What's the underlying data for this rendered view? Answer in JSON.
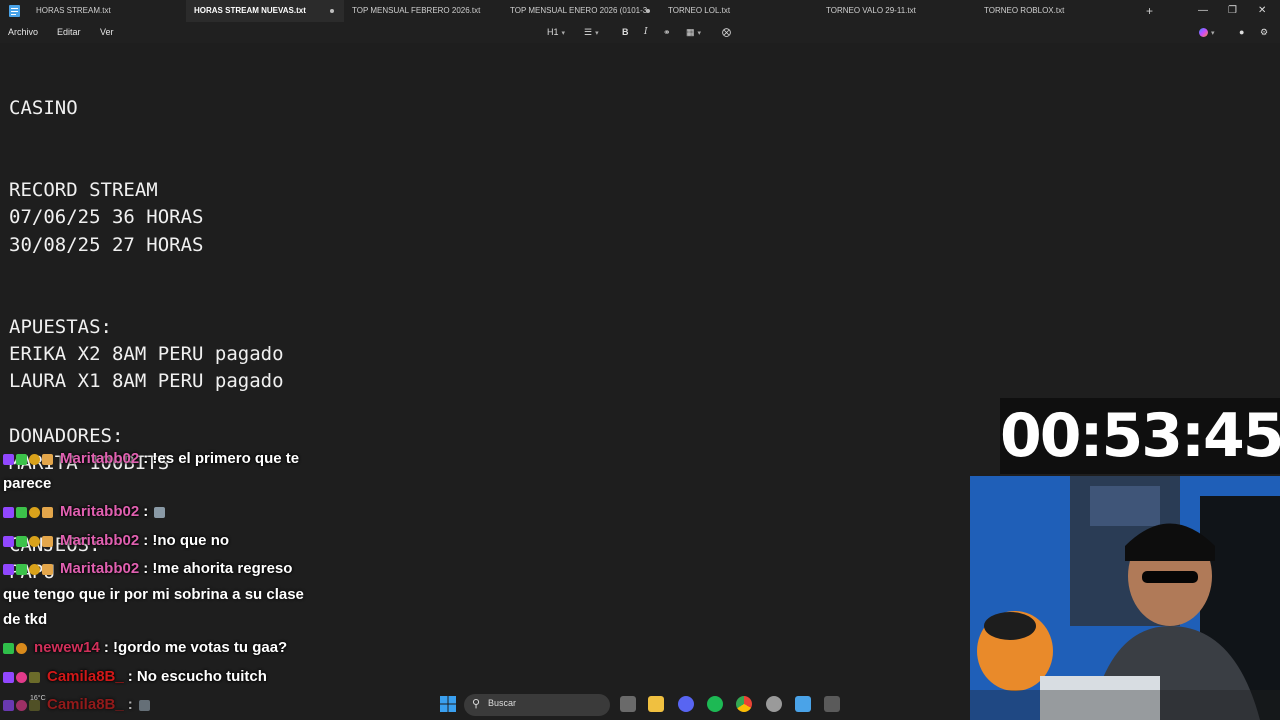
{
  "tabs": [
    {
      "label": "HORAS STREAM.txt"
    },
    {
      "label": "HORAS STREAM NUEVAS.txt"
    },
    {
      "label": "TOP MENSUAL FEBRERO 2026.txt"
    },
    {
      "label": "TOP MENSUAL ENERO 2026 (0101-3"
    },
    {
      "label": "TORNEO LOL.txt"
    },
    {
      "label": "TORNEO VALO 29-11.txt"
    },
    {
      "label": "TORNEO ROBLOX.txt"
    }
  ],
  "menu": {
    "file": "Archivo",
    "edit": "Editar",
    "view": "Ver"
  },
  "toolbar": {
    "heading": "H1"
  },
  "editor": {
    "lines": [
      "CASINO",
      "RECORD STREAM",
      "07/06/25 36 HORAS",
      "30/08/25 27 HORAS",
      "APUESTAS:",
      "ERIKA X2 8AM PERU pagado",
      "LAURA X1 8AM PERU pagado",
      "DONADORES:",
      "MARITA 100BITS",
      "CANJEOS:",
      "PAPU"
    ]
  },
  "timer": "00:53:45",
  "chat": {
    "messages": [
      {
        "user": "Maritabb02",
        "text": ": !es el primero que te",
        "cont": "parece",
        "color": "#e060b0"
      },
      {
        "user": "Maritabb02",
        "text": ":",
        "color": "#e060b0"
      },
      {
        "user": "Maritabb02",
        "text": ": !no que no",
        "color": "#e060b0"
      },
      {
        "user": "Maritabb02",
        "text": ": !me ahorita regreso",
        "cont1": "que tengo que ir por mi sobrina a su clase",
        "cont2": "de tkd",
        "color": "#e060b0"
      },
      {
        "user": "newew14",
        "text": ": !gordo me votas tu gaa?",
        "color": "#d0305a"
      },
      {
        "user": "Camila8B_",
        "text": ": No escucho tuitch",
        "color": "#d01818"
      },
      {
        "user": "Camila8B_",
        "text": ":",
        "color": "#d01818"
      }
    ]
  },
  "taskbar": {
    "search_placeholder": "Buscar",
    "weather": "16°C"
  },
  "colors": {
    "accent_dot": "#bdbdbd",
    "timer_bg": "#0f0f0f"
  }
}
